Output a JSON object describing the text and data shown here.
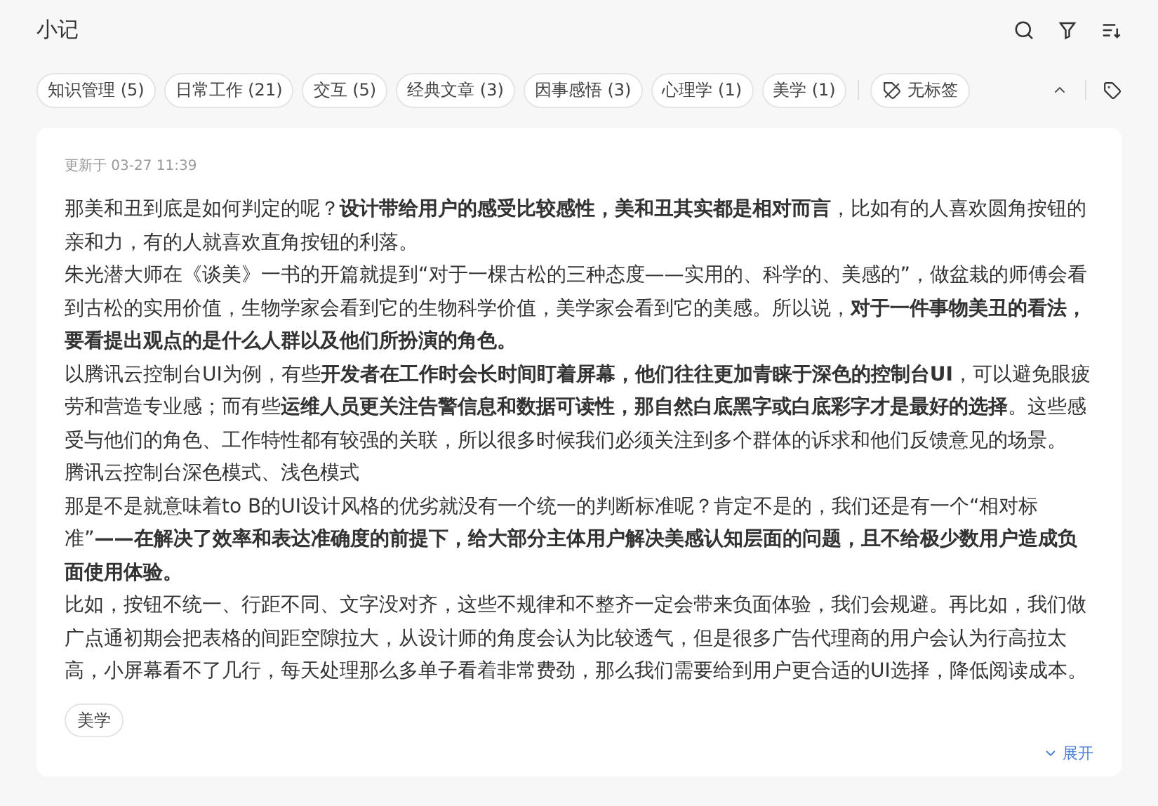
{
  "title": "小记",
  "tags": [
    {
      "label": "知识管理 (5)",
      "kind": "tag"
    },
    {
      "label": "日常工作 (21)",
      "kind": "tag"
    },
    {
      "label": "交互 (5)",
      "kind": "tag"
    },
    {
      "label": "经典文章 (3)",
      "kind": "tag"
    },
    {
      "label": "因事感悟 (3)",
      "kind": "tag"
    },
    {
      "label": "心理学 (1)",
      "kind": "tag"
    },
    {
      "label": "美学 (1)",
      "kind": "tag"
    },
    {
      "label": "无标签",
      "kind": "untagged"
    }
  ],
  "note": {
    "updated": "更新于 03-27 11:39",
    "paragraphs": [
      "那美和丑到底是如何判定的呢？**设计带给用户的感受比较感性，美和丑其实都是相对而言**，比如有的人喜欢圆角按钮的亲和力，有的人就喜欢直角按钮的利落。",
      "朱光潜大师在《谈美》一书的开篇就提到“对于一棵古松的三种态度——实用的、科学的、美感的”，做盆栽的师傅会看到古松的实用价值，生物学家会看到它的生物科学价值，美学家会看到它的美感。所以说，**对于一件事物美丑的看法，要看提出观点的是什么人群以及他们所扮演的角色。**",
      "以腾讯云控制台UI为例，有些**开发者在工作时会长时间盯着屏幕，他们往往更加青睐于深色的控制台UI**，可以避免眼疲劳和营造专业感；而有些**运维人员更关注告警信息和数据可读性，那自然白底黑字或白底彩字才是最好的选择**。这些感受与他们的角色、工作特性都有较强的关联，所以很多时候我们必须关注到多个群体的诉求和他们反馈意见的场景。",
      "腾讯云控制台深色模式、浅色模式",
      "那是不是就意味着to B的UI设计风格的优劣就没有一个统一的判断标准呢？肯定不是的，我们还是有一个“相对标准”**——在解决了效率和表达准确度的前提下，给大部分主体用户解决美感认知层面的问题，且不给极少数用户造成负面使用体验。**",
      "比如，按钮不统一、行距不同、文字没对齐，这些不规律和不整齐一定会带来负面体验，我们会规避。再比如，我们做广点通初期会把表格的间距空隙拉大，从设计师的角度会认为比较透气，但是很多广告代理商的用户会认为行高拉太高，小屏幕看不了几行，每天处理那么多单子看着非常费劲，那么我们需要给到用户更合适的UI选择，降低阅读成本。"
    ],
    "tags": [
      "美学"
    ],
    "expand": "展开"
  }
}
